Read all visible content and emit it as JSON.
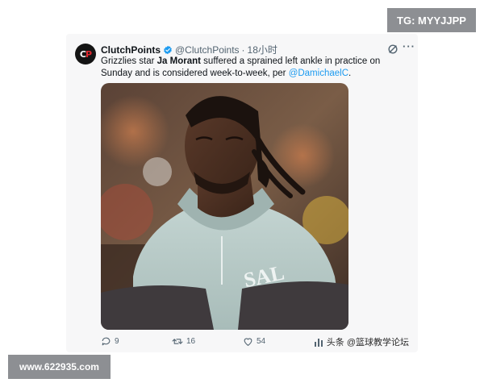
{
  "corner_badge_top": "TG: MYYJJPP",
  "corner_badge_bottom": "www.622935.com",
  "tweet": {
    "display_name": "ClutchPoints",
    "handle": "@ClutchPoints",
    "separator": "·",
    "time": "18小时",
    "text_1": "Grizzlies star ",
    "text_bold": "Ja Morant",
    "text_2": " suffered a sprained left ankle in practice on Sunday and is considered week-to-week, per ",
    "mention": "@DamichaelC",
    "text_end": ".",
    "avatar_text_a": "C",
    "avatar_text_b": "P",
    "more_label": "···",
    "photo_text": "SAL"
  },
  "actions": {
    "replies": "9",
    "reposts": "16",
    "likes": "54"
  },
  "watermark": "头条 @篮球教学论坛",
  "colors": {
    "badge_bg": "#8d8f93",
    "mention": "#1d9bf0",
    "verified": "#1d9bf0",
    "hoodie": "#b9ccc9"
  }
}
